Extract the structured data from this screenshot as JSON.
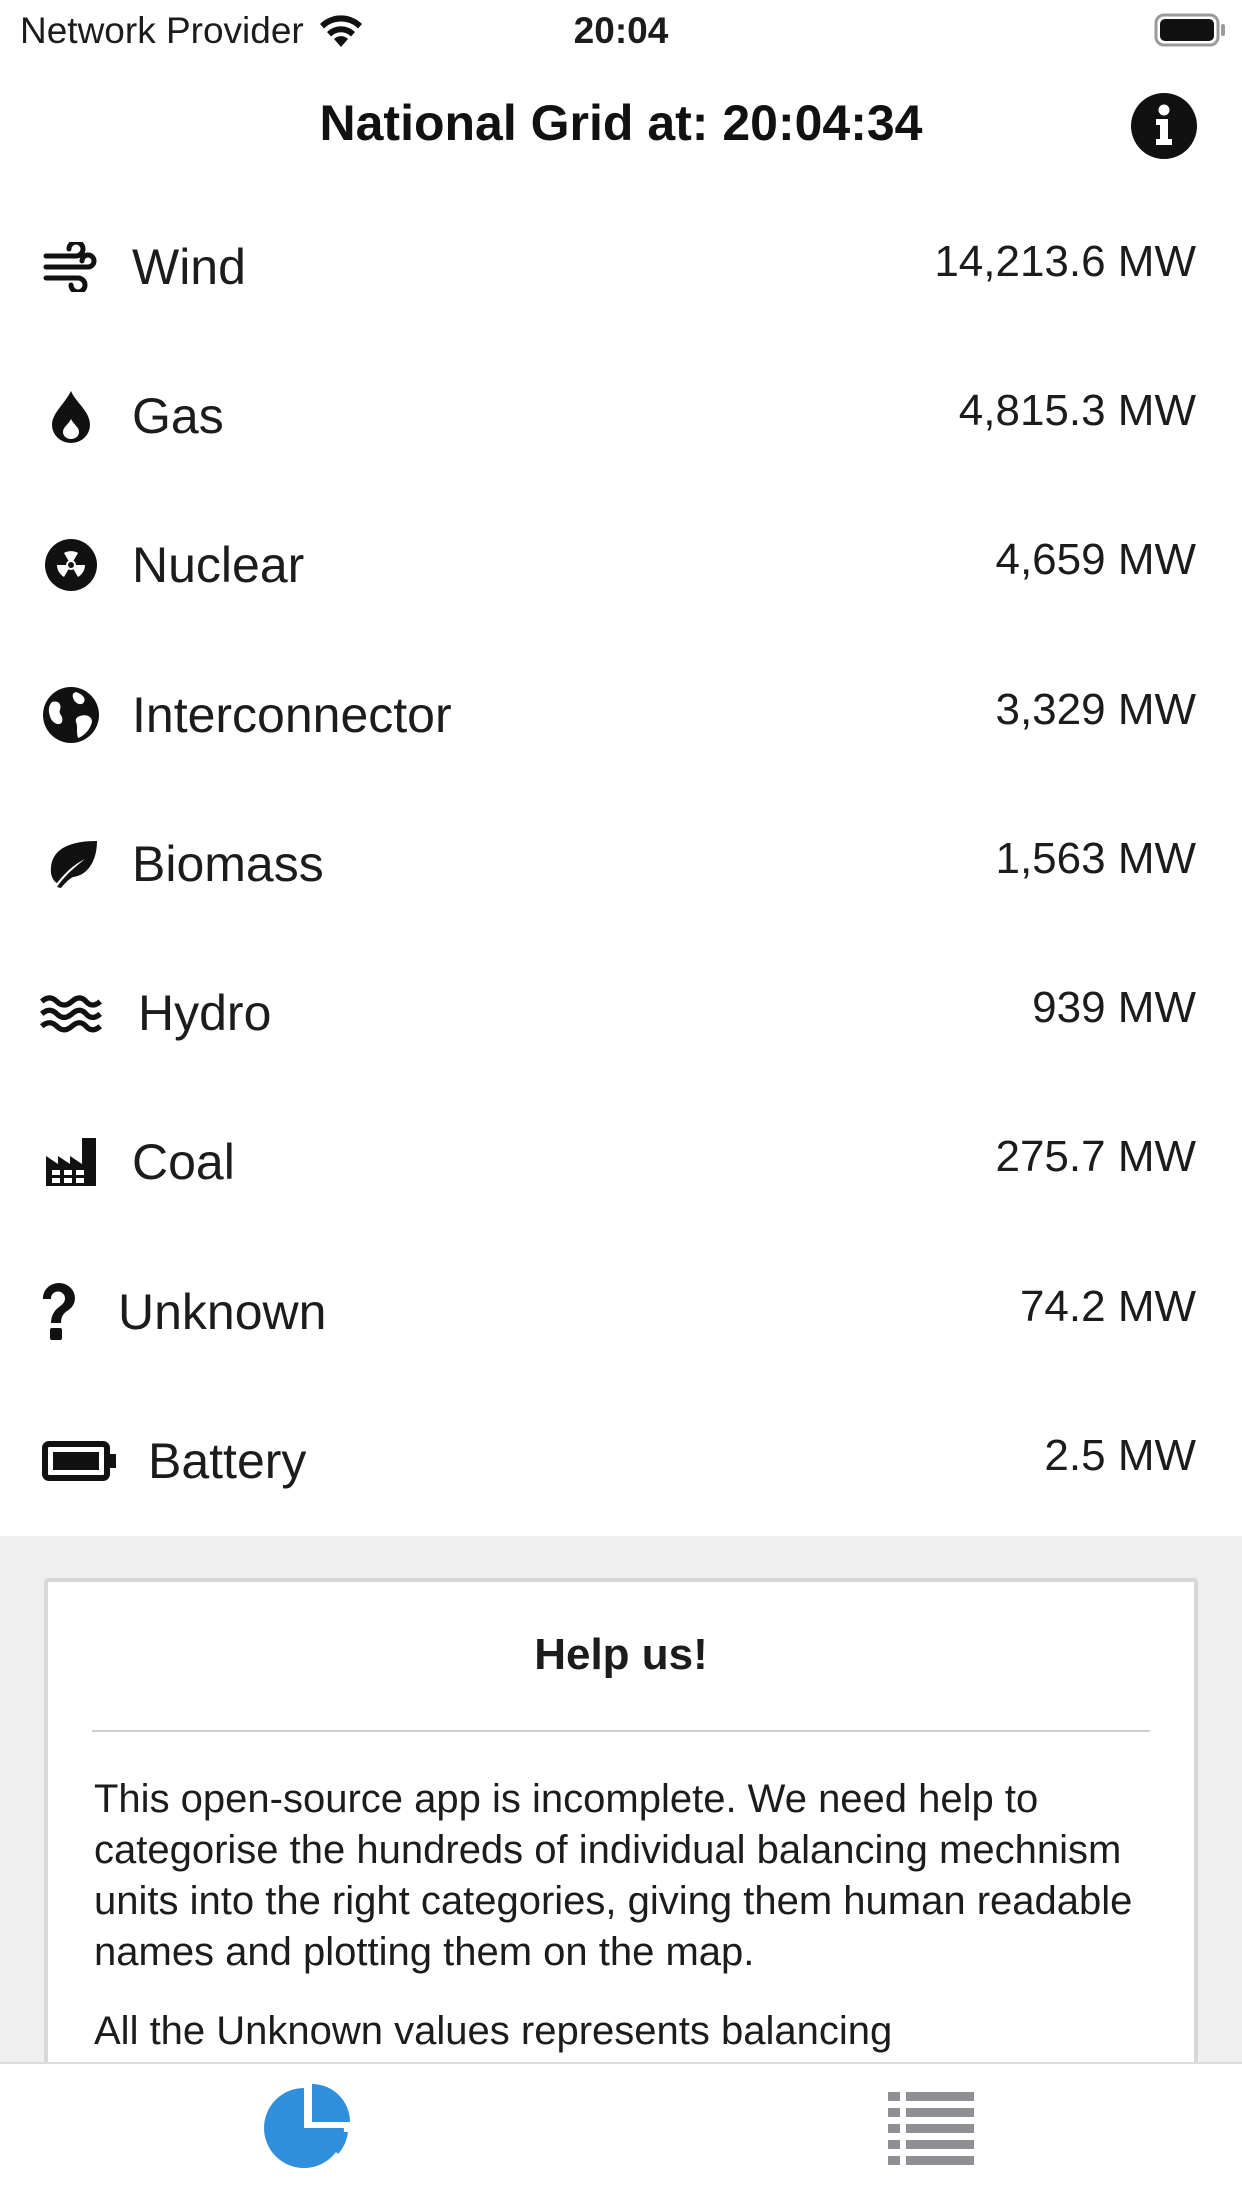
{
  "status_bar": {
    "carrier": "Network Provider",
    "time": "20:04"
  },
  "header": {
    "title": "National Grid at: 20:04:34",
    "info_icon": "info-circle-icon"
  },
  "generation": [
    {
      "name": "Wind",
      "value": "14,213.6 MW",
      "icon": "wind-icon"
    },
    {
      "name": "Gas",
      "value": "4,815.3 MW",
      "icon": "flame-icon"
    },
    {
      "name": "Nuclear",
      "value": "4,659 MW",
      "icon": "radiation-icon"
    },
    {
      "name": "Interconnector",
      "value": "3,329 MW",
      "icon": "globe-icon"
    },
    {
      "name": "Biomass",
      "value": "1,563 MW",
      "icon": "leaf-icon"
    },
    {
      "name": "Hydro",
      "value": "939 MW",
      "icon": "water-icon"
    },
    {
      "name": "Coal",
      "value": "275.7 MW",
      "icon": "factory-icon"
    },
    {
      "name": "Unknown",
      "value": "74.2 MW",
      "icon": "question-icon"
    },
    {
      "name": "Battery",
      "value": "2.5 MW",
      "icon": "battery-icon"
    }
  ],
  "help": {
    "title": "Help us!",
    "paragraph_1": "This open-source app is incomplete. We need help to categorise the hundreds of individual balancing mechnism units into the right categories, giving them human readable names and plotting them on the map.",
    "paragraph_2": "All the Unknown values represents balancing"
  },
  "tab_bar": {
    "tabs": [
      {
        "icon": "pie-chart-icon",
        "active": true
      },
      {
        "icon": "list-icon",
        "active": false
      }
    ]
  },
  "colors": {
    "accent": "#2f8fdd",
    "inactive_tab": "#8e8e93",
    "help_background": "#efeff0"
  }
}
